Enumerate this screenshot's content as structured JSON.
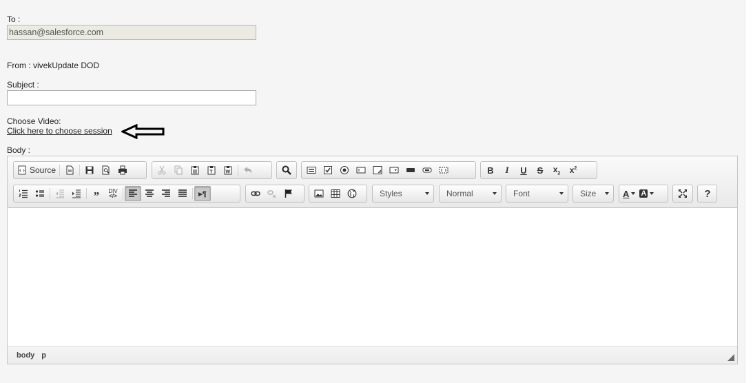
{
  "form": {
    "to_label": "To :",
    "to_value": "hassan@salesforce.com",
    "from_text": "From : vivekUpdate DOD",
    "subject_label": "Subject :",
    "subject_value": "",
    "video_label": "Choose Video:",
    "video_link": "Click here to choose session",
    "body_label": "Body :"
  },
  "toolbar": {
    "source_label": "Source",
    "styles_label": "Styles",
    "format_label": "Normal",
    "font_label": "Font",
    "size_label": "Size",
    "help_label": "?",
    "div_label": "DIV"
  },
  "icons": [
    "source-icon",
    "new-page-icon",
    "save-icon",
    "preview-icon",
    "print-icon",
    "cut-icon",
    "copy-icon",
    "paste-icon",
    "paste-text-icon",
    "paste-word-icon",
    "undo-icon",
    "find-icon",
    "form-icon",
    "checkbox-icon",
    "radio-icon",
    "textfield-icon",
    "textarea-icon",
    "select-icon",
    "button-icon",
    "image-button-icon",
    "hidden-field-icon",
    "bold-icon",
    "italic-icon",
    "underline-icon",
    "strike-icon",
    "subscript-icon",
    "superscript-icon",
    "numbered-list-icon",
    "bulleted-list-icon",
    "outdent-icon",
    "indent-icon",
    "blockquote-icon",
    "div-icon",
    "align-left-icon",
    "align-center-icon",
    "align-right-icon",
    "justify-icon",
    "ltr-icon",
    "link-icon",
    "unlink-icon",
    "anchor-icon",
    "image-icon",
    "table-icon",
    "iframe-icon",
    "text-color-icon",
    "bg-color-icon",
    "maximize-icon",
    "help-icon"
  ],
  "statusbar": {
    "path": [
      "body",
      "p"
    ]
  }
}
